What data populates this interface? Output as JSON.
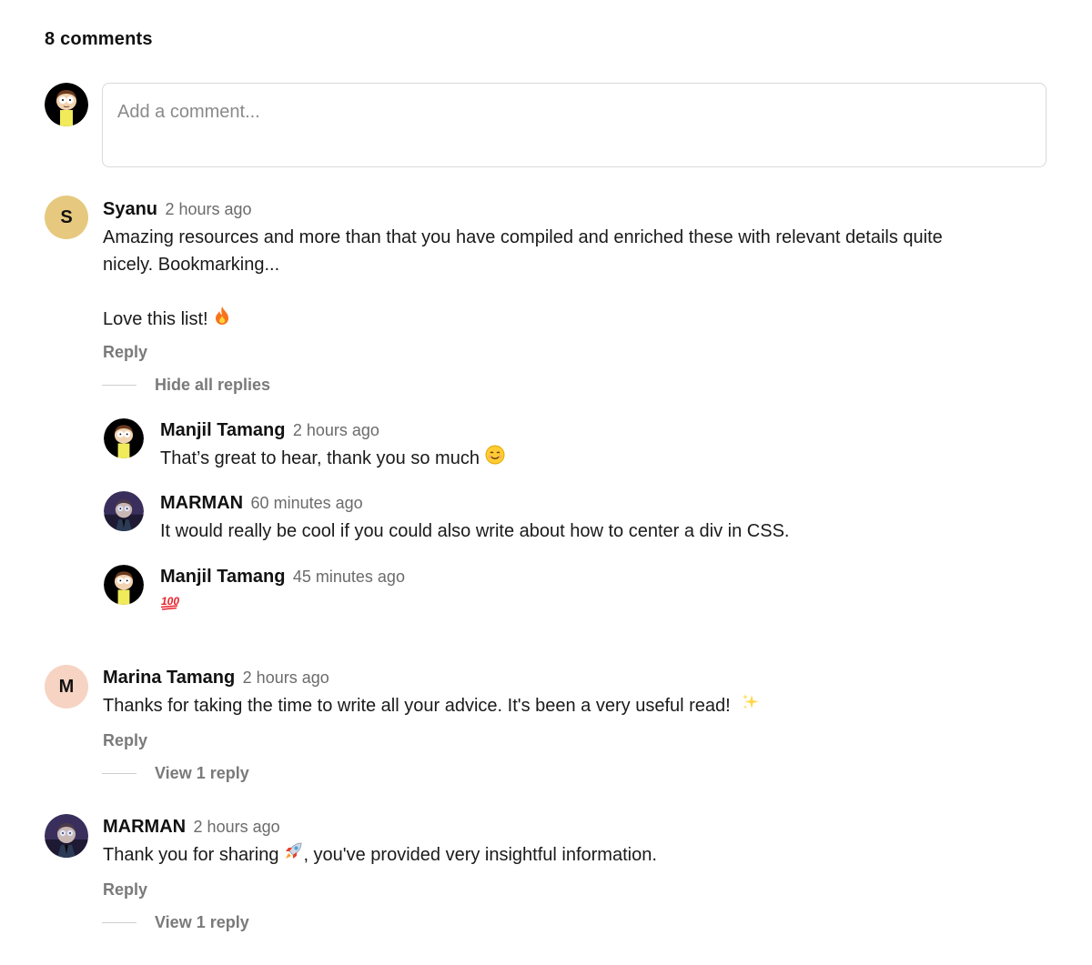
{
  "comments_header": {
    "count_label": "8 comments"
  },
  "composer": {
    "placeholder": "Add a comment..."
  },
  "comments": [
    {
      "author": "Syanu",
      "avatar_letter": "S",
      "avatar_color": "#e6c97e",
      "time": "2 hours ago",
      "body_lines": [
        "Amazing resources and more than that you have compiled and enriched these with relevant details quite",
        "nicely. Bookmarking...",
        "Love this list!"
      ],
      "body_emoji": "fire-icon",
      "reply_label": "Reply",
      "thread_label": "Hide all replies",
      "replies": [
        {
          "author": "Manjil Tamang",
          "time": "2 hours ago",
          "body": "That’s great to hear, thank you so much",
          "emoji": "smile-icon",
          "avatar": "morty-avatar"
        },
        {
          "author": "MARMAN",
          "time": "60 minutes ago",
          "body": "It would really be cool if you could also write about how to center a div in CSS.",
          "avatar": "evil-morty-avatar"
        },
        {
          "author": "Manjil Tamang",
          "time": "45 minutes ago",
          "body": "",
          "emoji": "hundred-icon",
          "avatar": "morty-avatar"
        }
      ]
    },
    {
      "author": "Marina Tamang",
      "avatar_letter": "M",
      "avatar_color": "#f6d3c2",
      "time": "2 hours ago",
      "body": "Thanks for taking the time to write all your advice. It's been a very useful read!",
      "body_emoji": "sparkles-icon",
      "reply_label": "Reply",
      "thread_label": "View 1 reply"
    },
    {
      "author": "MARMAN",
      "time": "2 hours ago",
      "body_before": "Thank you for sharing",
      "body_after": ", you've provided very insightful information.",
      "body_emoji": "rocket-icon",
      "reply_label": "Reply",
      "thread_label": "View 1 reply"
    }
  ]
}
